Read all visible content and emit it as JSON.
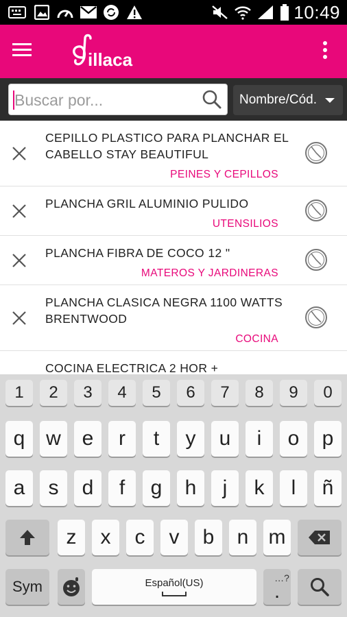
{
  "status_bar": {
    "time": "10:49",
    "icons": [
      "keyboard-icon",
      "image-icon",
      "speedometer-icon",
      "mail-icon",
      "sync-icon",
      "warning-icon",
      "mute-icon",
      "wifi-icon",
      "signal-icon",
      "battery-icon"
    ]
  },
  "app_bar": {
    "logo_text": "illaca",
    "brand_color": "#e8087a"
  },
  "search": {
    "placeholder": "Buscar por...",
    "filter_label": "Nombre/Cód."
  },
  "items": [
    {
      "title": "CEPILLO PLASTICO PARA PLANCHAR EL CABELLO STAY BEAUTIFUL",
      "category": "PEINES Y CEPILLOS"
    },
    {
      "title": "PLANCHA GRIL ALUMINIO PULIDO",
      "category": "UTENSILIOS"
    },
    {
      "title": "PLANCHA FIBRA DE COCO 12 \"",
      "category": "MATEROS Y JARDINERAS"
    },
    {
      "title": "PLANCHA CLASICA NEGRA 1100 WATTS BRENTWOOD",
      "category": "COCINA"
    },
    {
      "title": "COCINA ELECTRICA 2 HOR +",
      "category": ""
    }
  ],
  "keyboard": {
    "row_numbers": [
      "1",
      "2",
      "3",
      "4",
      "5",
      "6",
      "7",
      "8",
      "9",
      "0"
    ],
    "row1": [
      "q",
      "w",
      "e",
      "r",
      "t",
      "y",
      "u",
      "i",
      "o",
      "p"
    ],
    "row2": [
      "a",
      "s",
      "d",
      "f",
      "g",
      "h",
      "j",
      "k",
      "l",
      "ñ"
    ],
    "row3": [
      "z",
      "x",
      "c",
      "v",
      "b",
      "n",
      "m"
    ],
    "sym_label": "Sym",
    "space_label": "Español(US)",
    "period_label": ".",
    "period_hint": "…?",
    "shift_icon": "shift-arrow-icon",
    "backspace_icon": "backspace-icon",
    "emoji_icon": "emoji-icon",
    "search_icon": "search-icon"
  }
}
